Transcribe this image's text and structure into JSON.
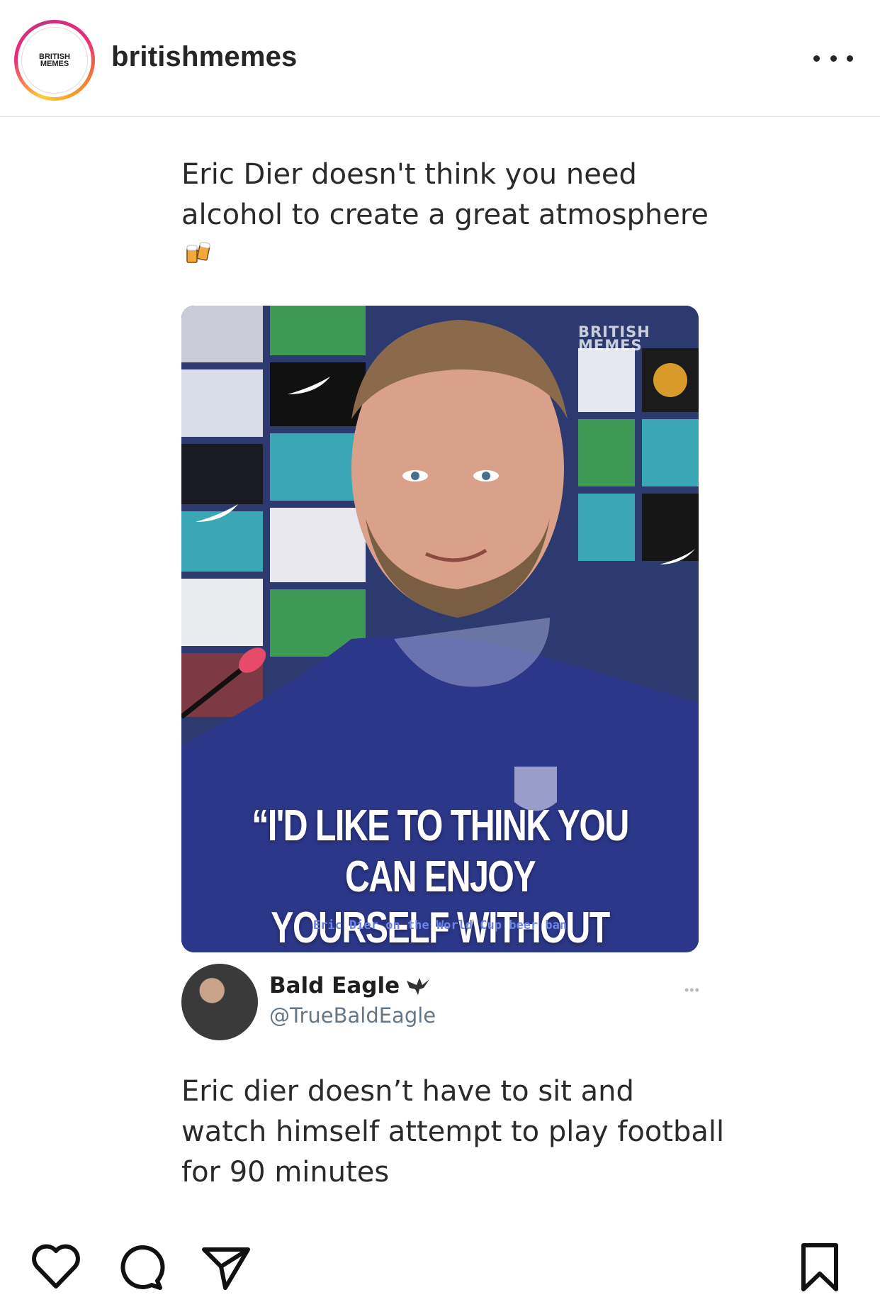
{
  "header": {
    "username": "britishmemes",
    "avatar_logo_line1": "BRITISH",
    "avatar_logo_line2": "MEMES"
  },
  "post": {
    "tweet_text": "Eric Dier doesn't think you need alcohol to create a great atmosphere",
    "tweet_emoji": "beer-mugs-emoji",
    "media": {
      "watermark_line1": "BRITISH",
      "watermark_line2": "MEMES",
      "quote_line1": "“I'D LIKE TO THINK YOU CAN ENJOY",
      "quote_line2": "YOURSELF WITHOUT ALCOHOL.”",
      "caption": "Eric Dier on the World Cup beer ban",
      "brand_color": "#2a3787"
    },
    "reply": {
      "name": "Bald Eagle",
      "handle": "@TrueBaldEagle",
      "more": "•••",
      "text": "Eric dier doesn’t have to sit and watch himself attempt to play football for 90 minutes"
    }
  },
  "actions": {
    "like_icon": "heart-icon",
    "comment_icon": "comment-icon",
    "share_icon": "send-icon",
    "save_icon": "bookmark-icon"
  }
}
